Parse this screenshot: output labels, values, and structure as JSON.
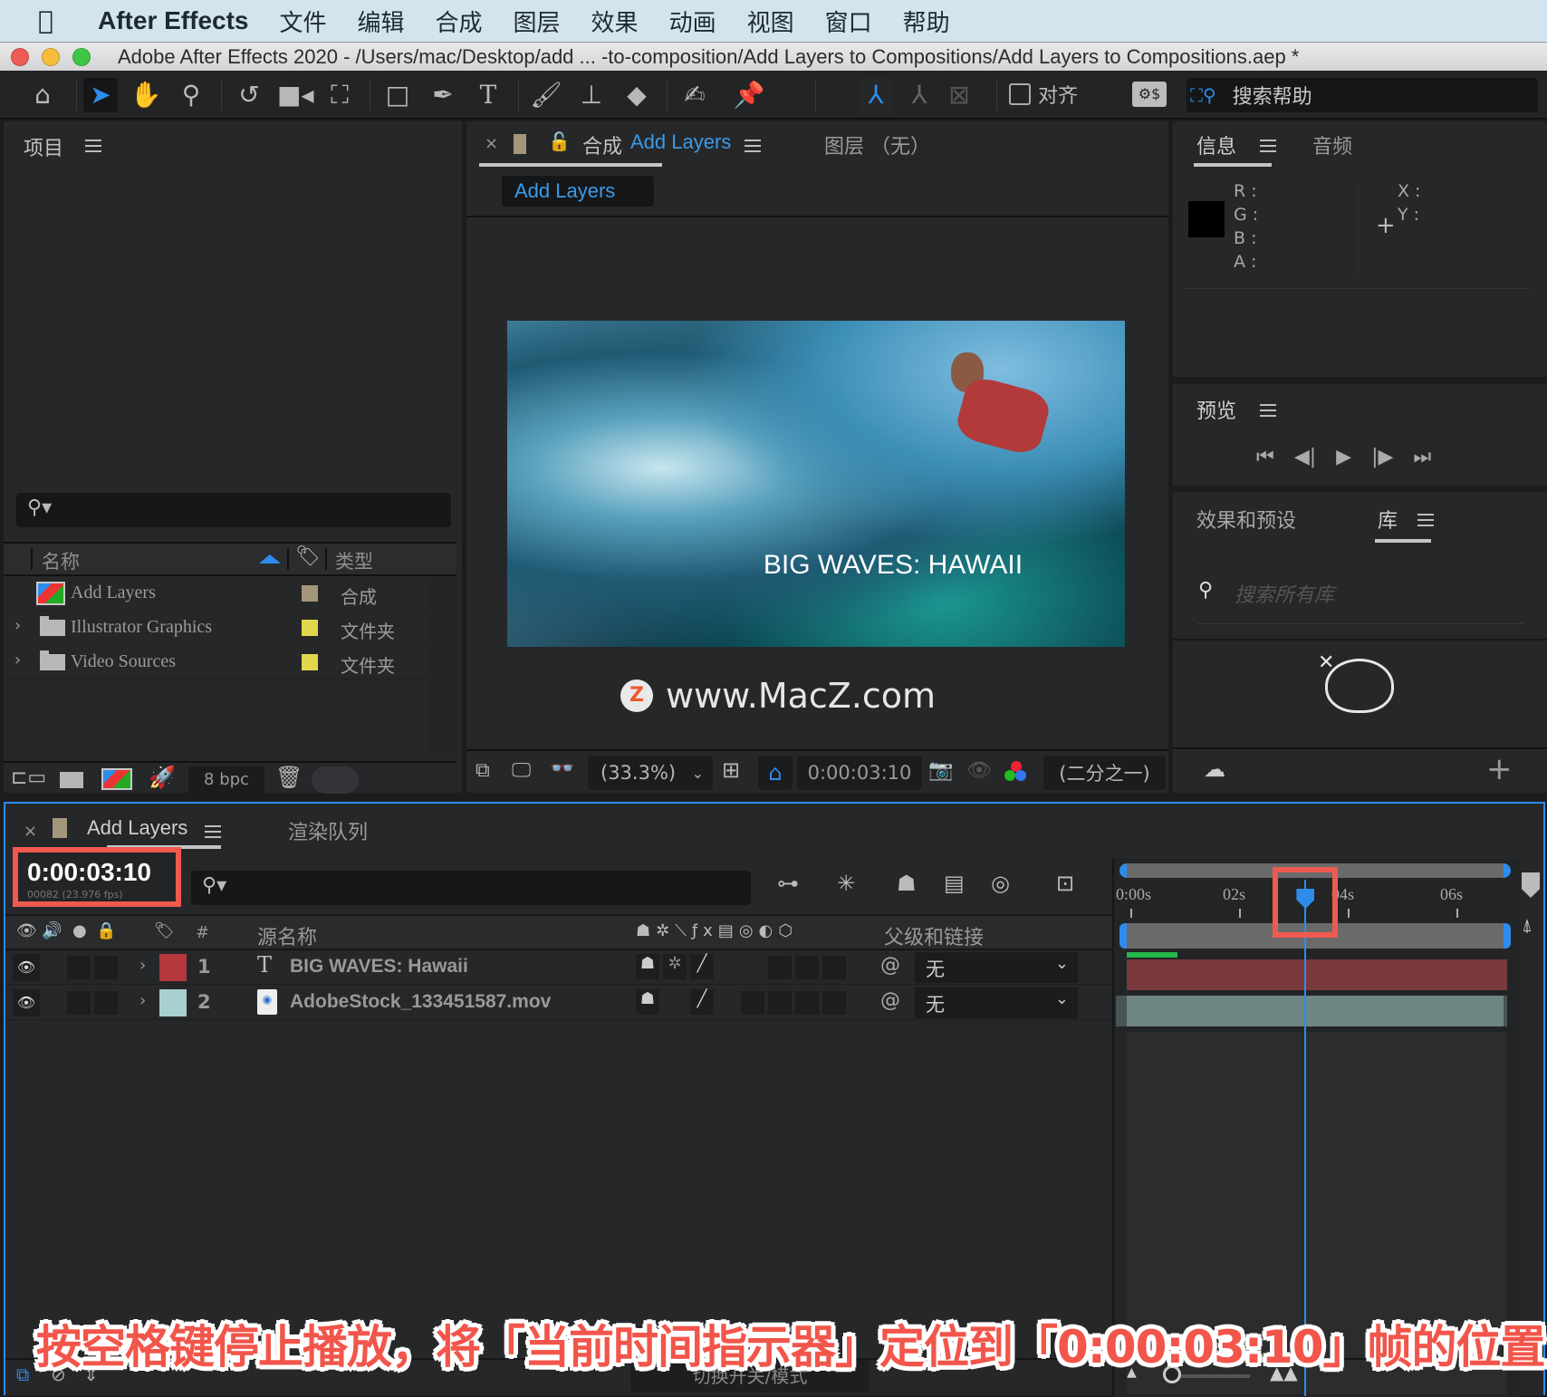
{
  "menubar": {
    "app_name": "After Effects",
    "items": [
      "文件",
      "编辑",
      "合成",
      "图层",
      "效果",
      "动画",
      "视图",
      "窗口",
      "帮助"
    ]
  },
  "window": {
    "title": "Adobe After Effects 2020 - /Users/mac/Desktop/add ... -to-composition/Add Layers to Compositions/Add Layers to Compositions.aep *"
  },
  "toolbar": {
    "tools": [
      "home-icon",
      "selection-tool-icon",
      "hand-tool-icon",
      "zoom-tool-icon",
      "rotate-tool-icon",
      "camera-tool-icon",
      "pan-behind-tool-icon",
      "rectangle-tool-icon",
      "pen-tool-icon",
      "type-tool-icon",
      "brush-tool-icon",
      "clone-stamp-tool-icon",
      "eraser-tool-icon",
      "roto-brush-tool-icon",
      "puppet-pin-tool-icon"
    ],
    "align_label": "对齐",
    "search_help": "搜索帮助"
  },
  "project": {
    "title": "项目",
    "col_name": "名称",
    "col_type": "类型",
    "items": [
      {
        "name": "Add Layers",
        "type": "合成",
        "color": "#a4967a",
        "kind": "composition"
      },
      {
        "name": "Illustrator Graphics",
        "type": "文件夹",
        "color": "#e2d74c",
        "kind": "folder"
      },
      {
        "name": "Video Sources",
        "type": "文件夹",
        "color": "#e2d74c",
        "kind": "folder"
      }
    ],
    "bpc": "8 bpc"
  },
  "composition": {
    "tab_prefix": "合成",
    "tab_name": "Add Layers",
    "layer_tab": "图层 （无）",
    "breadcrumb": "Add Layers",
    "viewer_title_text": "BIG WAVES: HAWAII",
    "watermark": "www.MacZ.com",
    "zoom": "(33.3%)",
    "timecode": "0:00:03:10",
    "resolution": "(二分之一)"
  },
  "info": {
    "tab_info": "信息",
    "tab_audio": "音频",
    "rgba_labels": [
      "R :",
      "G :",
      "B :",
      "A :"
    ],
    "xy_labels": [
      "X :",
      "Y :"
    ]
  },
  "preview": {
    "title": "预览",
    "controls": [
      "first-frame",
      "previous-frame",
      "play",
      "next-frame",
      "last-frame"
    ]
  },
  "libraries": {
    "tab_effects": "效果和预设",
    "tab_library": "库",
    "search_placeholder": "搜索所有库"
  },
  "timeline": {
    "tab_name": "Add Layers",
    "tab_render": "渲染队列",
    "current_time": "0:00:03:10",
    "frame_info": "00082 (23.976 fps)",
    "col_num": "#",
    "col_source": "源名称",
    "col_parent": "父级和链接",
    "ruler_labels": [
      "0:00s",
      "02s",
      "04s",
      "06s"
    ],
    "playhead_fraction": 0.47,
    "layers": [
      {
        "num": "1",
        "name": "BIG WAVES: Hawaii",
        "type": "text",
        "label_color": "#b5383c",
        "parent": "无",
        "bar_color": "#7a3a3d"
      },
      {
        "num": "2",
        "name": "AdobeStock_133451587.mov",
        "type": "footage",
        "label_color": "#a7d0ce",
        "parent": "无",
        "bar_color": "#6f8583"
      }
    ],
    "footer_toggle": "切换开关/模式"
  },
  "caption": "按空格键停止播放，将「当前时间指示器」定位到「0:00:03:10」帧的位置"
}
